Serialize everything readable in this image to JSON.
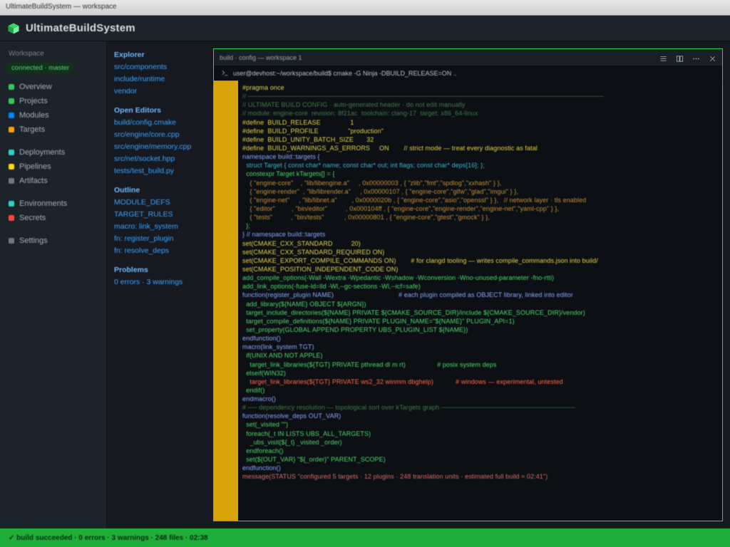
{
  "window": {
    "title": "UltimateBuildSystem — workspace"
  },
  "header": {
    "brand": "UltimateBuildSystem"
  },
  "sidebar": {
    "section1_label": "Workspace",
    "status_text": "connected · master",
    "items1": [
      {
        "label": "Overview",
        "dot": "green"
      },
      {
        "label": "Projects",
        "dot": "green"
      },
      {
        "label": "Modules",
        "dot": "blue"
      },
      {
        "label": "Targets",
        "dot": "orange"
      }
    ],
    "section2_label": "",
    "items2": [
      {
        "label": "Deployments",
        "dot": "teal"
      },
      {
        "label": "Pipelines",
        "dot": "yellow"
      },
      {
        "label": "Artifacts",
        "dot": "gray"
      }
    ],
    "items3": [
      {
        "label": "Environments",
        "dot": "teal"
      },
      {
        "label": "Secrets",
        "dot": "red"
      }
    ],
    "items4": [
      {
        "label": "Settings",
        "dot": "gray"
      }
    ]
  },
  "nav": {
    "groups": [
      {
        "head": "Explorer",
        "items": [
          "src/components",
          "include/runtime",
          "vendor"
        ]
      },
      {
        "head": "Open Editors",
        "items": [
          "build/config.cmake",
          "src/engine/core.cpp",
          "src/engine/memory.cpp",
          "src/net/socket.hpp",
          "tests/test_build.py"
        ]
      },
      {
        "head": "Outline",
        "items": [
          "MODULE_DEFS",
          "TARGET_RULES",
          "macro: link_system",
          "fn: register_plugin",
          "fn: resolve_deps"
        ]
      },
      {
        "head": "Problems",
        "items": [
          "0 errors · 3 warnings"
        ]
      }
    ]
  },
  "editor": {
    "tab_label": "build · config — workspace 1",
    "prompt": "user@devhost:~/workspace/build$  cmake -G Ninja -DBUILD_RELEASE=ON .."
  },
  "code_lines": [
    {
      "cls": "tok-kw",
      "t": "#pragma once"
    },
    {
      "cls": "tok-cm",
      "t": "// ─────────────────────────────────────────────────────────────────────────────"
    },
    {
      "cls": "tok-cm",
      "t": "// ULTIMATE BUILD CONFIG · auto-generated header · do not edit manually"
    },
    {
      "cls": "tok-cm",
      "t": "// module: engine-core  revision: 8f21ac  toolchain: clang-17  target: x86_64-linux"
    },
    {
      "cls": "tok-kw",
      "t": "#define  BUILD_RELEASE                1"
    },
    {
      "cls": "tok-kw",
      "t": "#define  BUILD_PROFILE                \"production\""
    },
    {
      "cls": "tok-kw",
      "t": "#define  BUILD_UNITY_BATCH_SIZE       32"
    },
    {
      "cls": "tok-kw",
      "t": "#define  BUILD_WARNINGS_AS_ERRORS     ON        // strict mode — treat every diagnostic as fatal"
    },
    {
      "cls": "tok-def",
      "t": "namespace build::targets {"
    },
    {
      "cls": "tok-ty",
      "t": "  struct Target { const char* name; const char* out; int flags; const char* deps[16]; };"
    },
    {
      "cls": "tok-fn",
      "t": "  constexpr Target kTargets[] = {"
    },
    {
      "cls": "tok-str",
      "t": "    { \"engine-core\"    , \"lib/libengine.a\"     , 0x00000003 , { \"zlib\",\"fmt\",\"spdlog\",\"xxhash\" } },"
    },
    {
      "cls": "tok-str",
      "t": "    { \"engine-render\"  , \"lib/librender.a\"     , 0x00000107 , { \"engine-core\",\"glfw\",\"glad\",\"imgui\" } },"
    },
    {
      "cls": "tok-str",
      "t": "    { \"engine-net\"     , \"lib/libnet.a\"        , 0x0000020b , { \"engine-core\",\"asio\",\"openssl\" } },   // network layer · tls enabled"
    },
    {
      "cls": "tok-str",
      "t": "    { \"editor\"         , \"bin/editor\"          , 0x000104ff , { \"engine-core\",\"engine-render\",\"engine-net\",\"yaml-cpp\" } },"
    },
    {
      "cls": "tok-str",
      "t": "    { \"tests\"          , \"bin/tests\"           , 0x00000801 , { \"engine-core\",\"gtest\",\"gmock\" } },"
    },
    {
      "cls": "tok-fn",
      "t": "  };"
    },
    {
      "cls": "tok-def",
      "t": "} // namespace build::targets"
    },
    {
      "cls": "tok-cm",
      "t": ""
    },
    {
      "cls": "tok-kw",
      "t": "set(CMAKE_CXX_STANDARD          20)"
    },
    {
      "cls": "tok-kw",
      "t": "set(CMAKE_CXX_STANDARD_REQUIRED ON)"
    },
    {
      "cls": "tok-kw",
      "t": "set(CMAKE_EXPORT_COMPILE_COMMANDS ON)        # for clangd tooling — writes compile_commands.json into build/"
    },
    {
      "cls": "tok-kw",
      "t": "set(CMAKE_POSITION_INDEPENDENT_CODE ON)"
    },
    {
      "cls": "tok-fn",
      "t": "add_compile_options(-Wall -Wextra -Wpedantic -Wshadow -Wconversion -Wno-unused-parameter -fno-rtti)"
    },
    {
      "cls": "tok-fn",
      "t": "add_link_options(-fuse-ld=lld -Wl,--gc-sections -Wl,--icf=safe)"
    },
    {
      "cls": "tok-cm",
      "t": ""
    },
    {
      "cls": "tok-def",
      "t": "function(register_plugin NAME)                                   # each plugin compiled as OBJECT library, linked into editor"
    },
    {
      "cls": "tok-fn",
      "t": "  add_library(${NAME} OBJECT ${ARGN})"
    },
    {
      "cls": "tok-fn",
      "t": "  target_include_directories(${NAME} PRIVATE ${CMAKE_SOURCE_DIR}/include ${CMAKE_SOURCE_DIR}/vendor)"
    },
    {
      "cls": "tok-fn",
      "t": "  target_compile_definitions(${NAME} PRIVATE PLUGIN_NAME=\"${NAME}\" PLUGIN_API=1)"
    },
    {
      "cls": "tok-fn",
      "t": "  set_property(GLOBAL APPEND PROPERTY UBS_PLUGIN_LIST ${NAME})"
    },
    {
      "cls": "tok-def",
      "t": "endfunction()"
    },
    {
      "cls": "tok-cm",
      "t": ""
    },
    {
      "cls": "tok-def",
      "t": "macro(link_system TGT)"
    },
    {
      "cls": "tok-fn",
      "t": "  if(UNIX AND NOT APPLE)"
    },
    {
      "cls": "tok-fn",
      "t": "    target_link_libraries(${TGT} PRIVATE pthread dl m rt)                 # posix system deps"
    },
    {
      "cls": "tok-fn",
      "t": "  elseif(WIN32)"
    },
    {
      "cls": "tok-err",
      "t": "    target_link_libraries(${TGT} PRIVATE ws2_32 winmm dbghelp)            # windows — experimental, untested"
    },
    {
      "cls": "tok-fn",
      "t": "  endif()"
    },
    {
      "cls": "tok-def",
      "t": "endmacro()"
    },
    {
      "cls": "tok-cm",
      "t": ""
    },
    {
      "cls": "tok-cm",
      "t": "# ── dependency resolution — topological sort over kTargets graph ─────────────────────────────"
    },
    {
      "cls": "tok-def",
      "t": "function(resolve_deps OUT_VAR)"
    },
    {
      "cls": "tok-fn",
      "t": "  set(_visited \"\")"
    },
    {
      "cls": "tok-fn",
      "t": "  foreach(_t IN LISTS UBS_ALL_TARGETS)"
    },
    {
      "cls": "tok-fn",
      "t": "    _ubs_visit(${_t} _visited _order)"
    },
    {
      "cls": "tok-fn",
      "t": "  endforeach()"
    },
    {
      "cls": "tok-fn",
      "t": "  set(${OUT_VAR} \"${_order}\" PARENT_SCOPE)"
    },
    {
      "cls": "tok-def",
      "t": "endfunction()"
    },
    {
      "cls": "tok-cm",
      "t": ""
    },
    {
      "cls": "tok-num",
      "t": "message(STATUS \"configured 5 targets · 12 plugins · 248 translation units · estimated full build ≈ 02:41\")"
    }
  ],
  "footer": {
    "text": "✓ build succeeded · 0 errors · 3 warnings · 248 files · 02:38"
  }
}
